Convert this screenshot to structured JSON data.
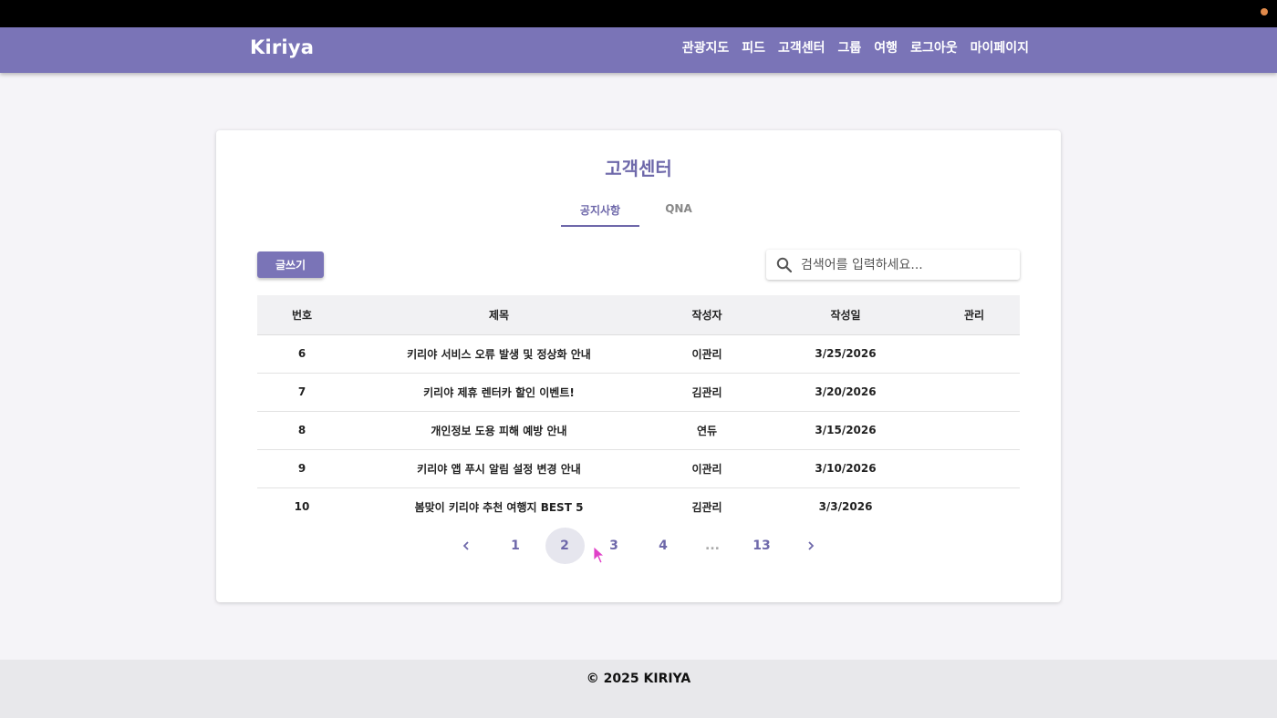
{
  "brand": "Kiriya",
  "nav": [
    "관광지도",
    "피드",
    "고객센터",
    "그룹",
    "여행",
    "로그아웃",
    "마이페이지"
  ],
  "page_title": "고객센터",
  "tabs": [
    {
      "label": "공지사항",
      "active": true
    },
    {
      "label": "QNA",
      "active": false
    }
  ],
  "write_button": "글쓰기",
  "search": {
    "placeholder": "검색어를 입력하세요..."
  },
  "table": {
    "headers": [
      "번호",
      "제목",
      "작성자",
      "작성일",
      "관리"
    ],
    "rows": [
      [
        "6",
        "키리야 서비스 오류 발생 및 정상화 안내",
        "이관리",
        "3/25/2026",
        ""
      ],
      [
        "7",
        "키리야 제휴 렌터카 할인 이벤트!",
        "김관리",
        "3/20/2026",
        ""
      ],
      [
        "8",
        "개인정보 도용 피해 예방 안내",
        "연듀",
        "3/15/2026",
        ""
      ],
      [
        "9",
        "키리야 앱 푸시 알림 설정 변경 안내",
        "이관리",
        "3/10/2026",
        ""
      ],
      [
        "10",
        "봄맞이 키리야 추천 여행지 BEST 5",
        "김관리",
        "3/3/2026",
        ""
      ]
    ]
  },
  "pagination": {
    "pages": [
      "1",
      "2",
      "3",
      "4",
      "...",
      "13"
    ],
    "current": "2"
  },
  "footer": "© 2025 KIRIYA",
  "colors": {
    "accent": "#7a74b7",
    "title": "#6e68aa"
  }
}
